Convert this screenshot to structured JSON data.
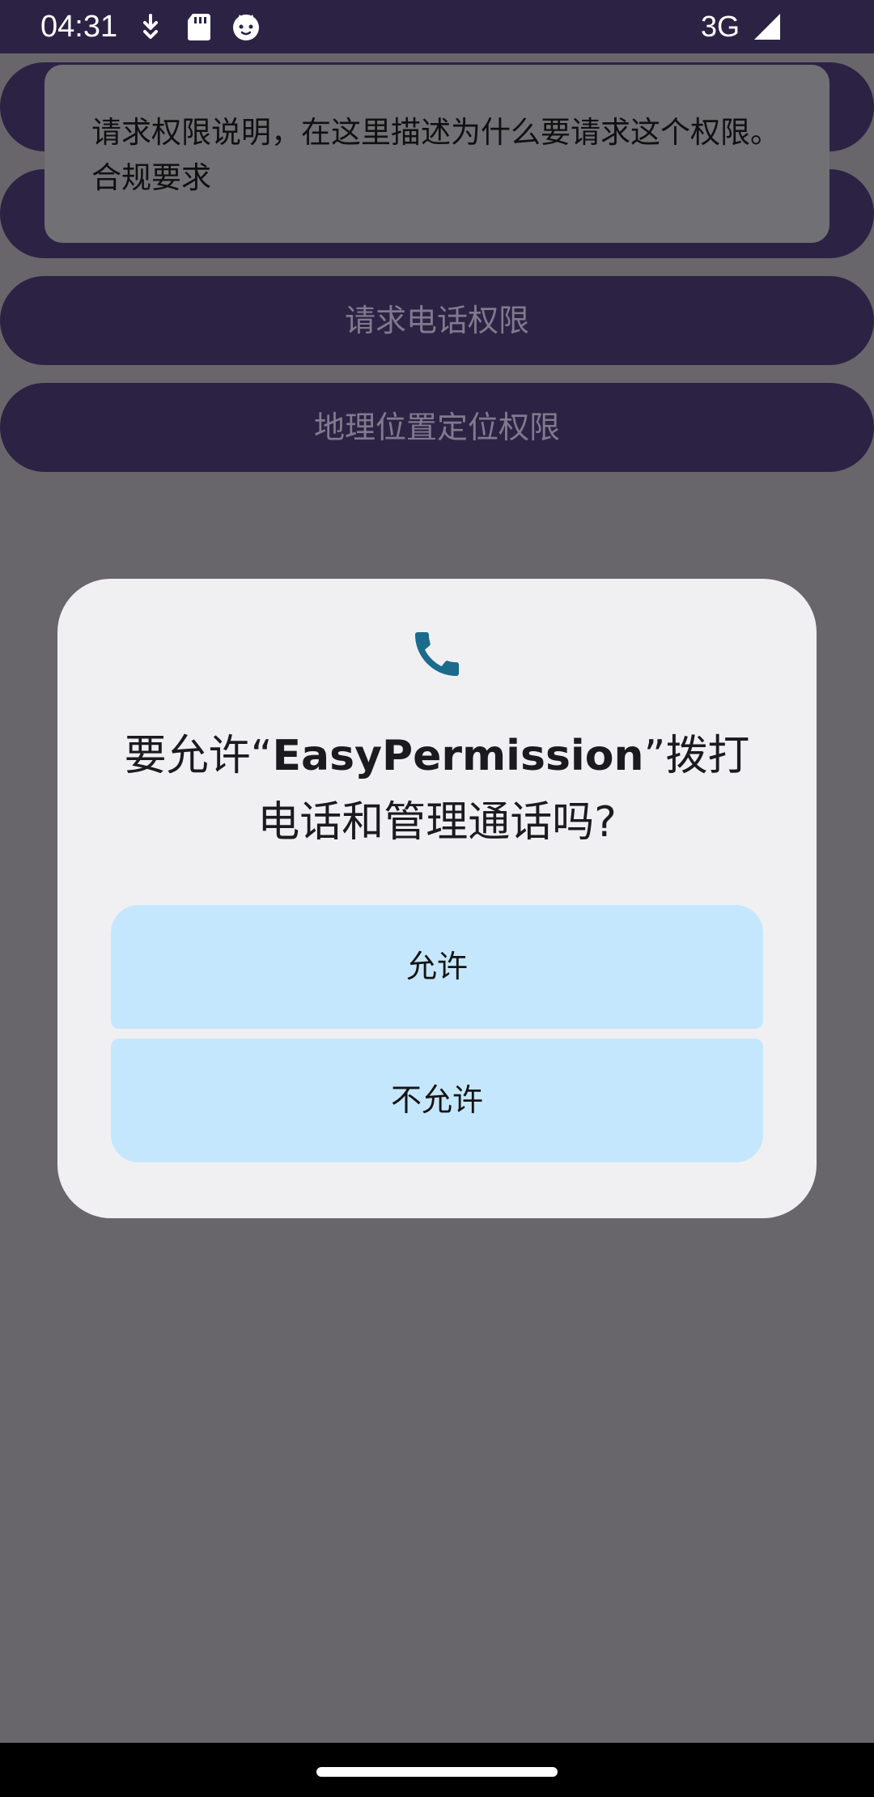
{
  "status_bar": {
    "time": "04:31",
    "network": "3G",
    "icons": [
      "download-notification-icon",
      "sd-card-icon",
      "cat-app-icon",
      "signal-icon"
    ]
  },
  "background_buttons": [
    {
      "label": ""
    },
    {
      "label": ""
    },
    {
      "label": "请求电话权限"
    },
    {
      "label": "地理位置定位权限"
    }
  ],
  "explanation": {
    "text": "请求权限说明，在这里描述为什么要请求这个权限。合规要求"
  },
  "dialog": {
    "icon": "phone-icon",
    "title_prefix": "要允许“",
    "app_name": "EasyPermission",
    "title_suffix": "”拨打电话和管理通话吗?",
    "allow_label": "允许",
    "deny_label": "不允许"
  },
  "colors": {
    "header_purple": "#2c2344",
    "scrim_gray": "#68666b",
    "dialog_surface": "#f0f0f3",
    "dialog_button": "#c5e7fd",
    "phone_icon": "#1a6b8c"
  }
}
